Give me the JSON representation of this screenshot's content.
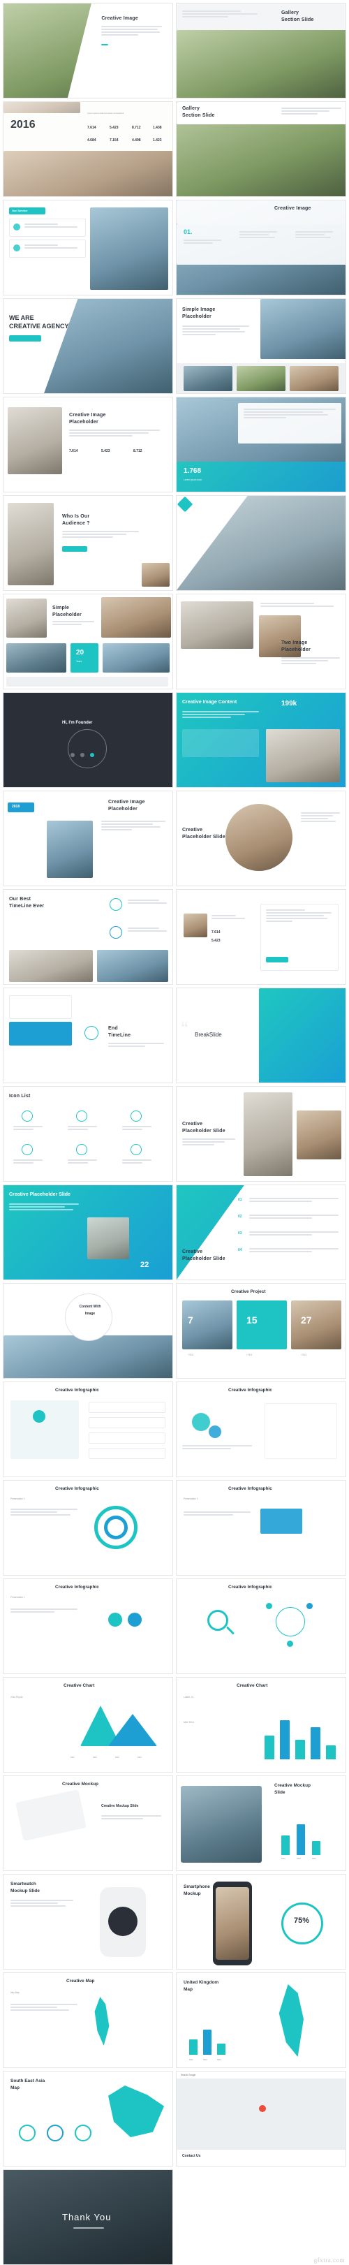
{
  "meta": {
    "watermark": "gfxtra.com",
    "accent_teal": "#1ec4c4",
    "accent_blue": "#1e9fd4",
    "dark": "#2b2f38"
  },
  "slides": [
    {
      "id": 1,
      "title": "Creative Image",
      "sub": ""
    },
    {
      "id": 2,
      "title": "Gallery",
      "title2": "Section Slide",
      "sub": ""
    },
    {
      "id": 3,
      "title": "2016",
      "sub": "",
      "numbers": [
        "7.614",
        "5.423",
        "8.712",
        "1.438"
      ],
      "numbers2": [
        "4.684",
        "7.154",
        "4.498",
        "1.423"
      ]
    },
    {
      "id": 4,
      "title": "Gallery",
      "title2": "Section Slide"
    },
    {
      "id": 5,
      "title": "Our Service",
      "sub": "Lorem ipsum dolor sit amet, consectetur adipiscing elit."
    },
    {
      "id": 6,
      "title": "Creative Image",
      "kicker": "01.",
      "sub": "Lorem ipsum dolor sit amet"
    },
    {
      "id": 7,
      "title": "WE ARE",
      "title2": "CREATIVE AGENCY"
    },
    {
      "id": 8,
      "title": "Simple Image",
      "title2": "Placeholder"
    },
    {
      "id": 9,
      "title": "Creative Image",
      "title2": "Placeholder",
      "numbers": [
        "7.614",
        "5.423",
        "8.712"
      ]
    },
    {
      "id": 10,
      "title": "1.768",
      "sub": "Lorem ipsum dolor"
    },
    {
      "id": 11,
      "title": "Who Is Our",
      "title2": "Audience ?"
    },
    {
      "id": 12,
      "title": ""
    },
    {
      "id": 13,
      "title": "Simple",
      "title2": "Placeholder",
      "badge": "20",
      "badgesub": "Years"
    },
    {
      "id": 14,
      "title": "Two Image",
      "title2": "Placeholder"
    },
    {
      "id": 15,
      "title": "Hi, I'm Founder",
      "sub": "Lorem ipsum dolor sit amet consectetur"
    },
    {
      "id": 16,
      "title": "Creative Image Content",
      "big": "199k"
    },
    {
      "id": 17,
      "title": "Creative Image",
      "title2": "Placeholder",
      "badge": "2018"
    },
    {
      "id": 18,
      "title": "Creative",
      "title2": "Placeholder Slide"
    },
    {
      "id": 19,
      "title": "Our Best",
      "title2": "TimeLine Ever"
    },
    {
      "id": 20,
      "title": "",
      "numbers": [
        "7.614",
        "5.423"
      ]
    },
    {
      "id": 21,
      "title": "End",
      "title2": "TimeLine"
    },
    {
      "id": 22,
      "title": "BreakSlide"
    },
    {
      "id": 23,
      "title": "Icon List"
    },
    {
      "id": 24,
      "title": "Creative",
      "title2": "Placeholder Slide"
    },
    {
      "id": 25,
      "title": "Creative Placeholder Slide",
      "badge": "22"
    },
    {
      "id": 26,
      "title": "Creative",
      "title2": "Placeholder Slide",
      "steps": [
        "01",
        "02",
        "03",
        "04"
      ]
    },
    {
      "id": 27,
      "title": "Content With",
      "title2": "Image"
    },
    {
      "id": 28,
      "title": "Creative Project",
      "stats": [
        "7",
        "15",
        "27"
      ],
      "substats": [
        "+78,5",
        "+78,5",
        "+78,5"
      ]
    },
    {
      "id": 29,
      "title": "Creative Infographic"
    },
    {
      "id": 30,
      "title": "Creative Infographic"
    },
    {
      "id": 31,
      "title": "Creative Infographic",
      "label": "Presentation 1"
    },
    {
      "id": 32,
      "title": "Creative Infographic",
      "label": "Presentation 1"
    },
    {
      "id": 33,
      "title": "Creative Infographic",
      "label": "Presentation 1"
    },
    {
      "id": 34,
      "title": "Creative Infographic"
    },
    {
      "id": 35,
      "title": "Creative Chart",
      "label": "2016 Report",
      "axis": [
        "M01",
        "M02",
        "M03",
        "M04"
      ]
    },
    {
      "id": 36,
      "title": "Creative Chart",
      "label": "LABEL 01",
      "label2": "MAY 2016"
    },
    {
      "id": 37,
      "title": "Creative Mockup",
      "title2": "Creative Mockup Slide"
    },
    {
      "id": 38,
      "title": "Creative Mockup",
      "title2": "Slide",
      "axis": [
        "M01",
        "M02",
        "M03"
      ]
    },
    {
      "id": 39,
      "title": "Smartwatch",
      "title2": "Mockup Slide"
    },
    {
      "id": 40,
      "title": "Smartphone",
      "title2": "Mockup",
      "percent": "75%"
    },
    {
      "id": 41,
      "title": "Creative Map",
      "title2": "Italy Map"
    },
    {
      "id": 42,
      "title": "United Kingdom",
      "title2": "Map",
      "axis": [
        "M01",
        "M02",
        "M03"
      ]
    },
    {
      "id": 43,
      "title": "South East Asia",
      "title2": "Map"
    },
    {
      "id": 44,
      "title": "Contact Us",
      "title2": "Search Google"
    },
    {
      "id": 45,
      "title": "Thank You"
    }
  ],
  "footer": {
    "contact_title": "Contact Us",
    "thank_you": "Thank You"
  }
}
